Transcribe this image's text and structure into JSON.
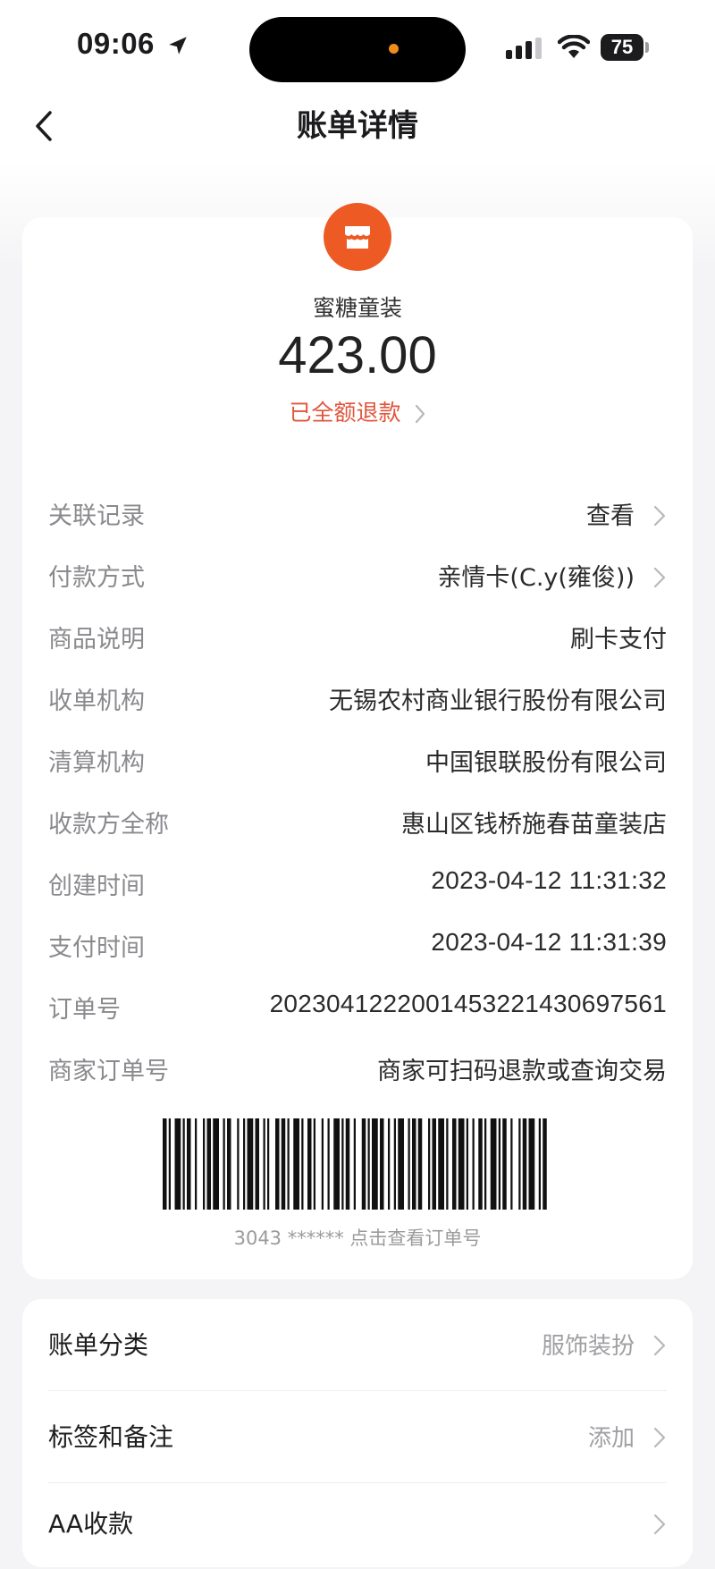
{
  "status_bar": {
    "time": "09:06",
    "battery": "75"
  },
  "nav": {
    "title": "账单详情"
  },
  "merchant": {
    "name": "蜜糖童装",
    "amount": "423.00",
    "status": "已全额退款"
  },
  "details": [
    {
      "label": "关联记录",
      "value": "查看",
      "chevron": true
    },
    {
      "label": "付款方式",
      "value": "亲情卡(C.y(雍俊))",
      "chevron": true
    },
    {
      "label": "商品说明",
      "value": "刷卡支付",
      "chevron": false
    },
    {
      "label": "收单机构",
      "value": "无锡农村商业银行股份有限公司",
      "chevron": false
    },
    {
      "label": "清算机构",
      "value": "中国银联股份有限公司",
      "chevron": false
    },
    {
      "label": "收款方全称",
      "value": "惠山区钱桥施春苗童装店",
      "chevron": false
    },
    {
      "label": "创建时间",
      "value": "2023-04-12 11:31:32",
      "chevron": false
    },
    {
      "label": "支付时间",
      "value": "2023-04-12 11:31:39",
      "chevron": false
    },
    {
      "label": "订单号",
      "value": "2023041222001453221430697561",
      "chevron": false
    },
    {
      "label": "商家订单号",
      "value": "商家可扫码退款或查询交易",
      "chevron": false
    }
  ],
  "barcode_caption": "3043 ****** 点击查看订单号",
  "settings": [
    {
      "label": "账单分类",
      "value": "服饰装扮"
    },
    {
      "label": "标签和备注",
      "value": "添加"
    },
    {
      "label": "AA收款",
      "value": ""
    }
  ],
  "colors": {
    "accent": "#ee5a24",
    "refund": "#e1553c"
  }
}
